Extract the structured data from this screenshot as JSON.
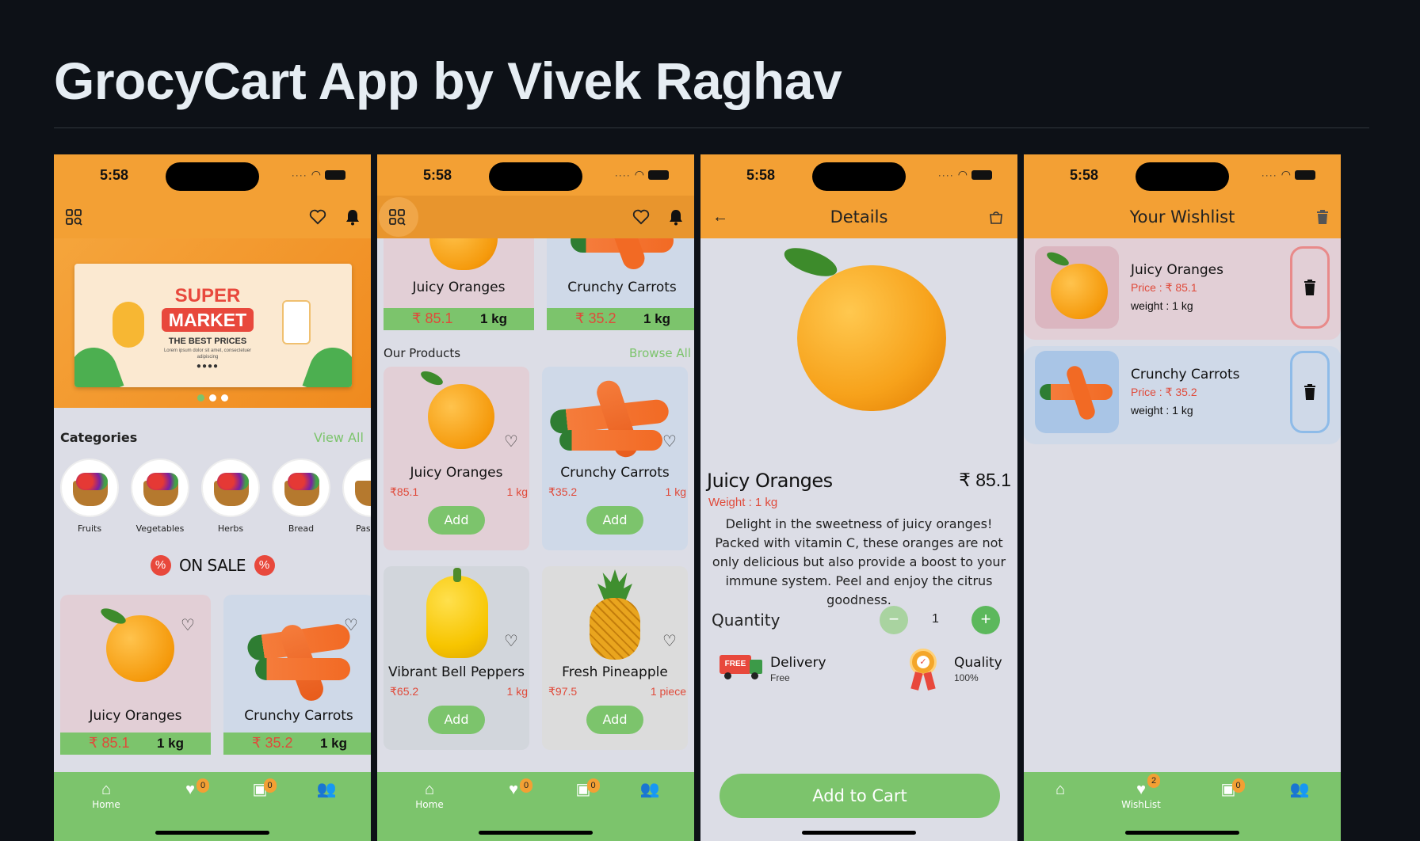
{
  "page": {
    "title": "GrocyCart App by Vivek Raghav"
  },
  "status": {
    "time": "5:58"
  },
  "colors": {
    "accent": "#f3a034",
    "green": "#7cc46c",
    "price_red": "#e04a3a",
    "background": "#0d1117"
  },
  "screen1": {
    "banner": {
      "line1": "SUPER",
      "line2": "MARKET",
      "line3": "THE BEST PRICES",
      "small": "Lorem ipsum dolor sit amet, consectetuer adipiscing"
    },
    "categories_title": "Categories",
    "view_all": "View All",
    "categories": [
      "Fruits",
      "Vegetables",
      "Herbs",
      "Bread",
      "Pas"
    ],
    "on_sale": "ON SALE",
    "sale_items": [
      {
        "name": "Juicy Oranges",
        "price": "₹ 85.1",
        "weight": "1 kg"
      },
      {
        "name": "Crunchy Carrots",
        "price": "₹ 35.2",
        "weight": "1 kg"
      }
    ],
    "nav": {
      "home": "Home",
      "wish_badge": "0",
      "cart_badge": "0"
    }
  },
  "screen2": {
    "top_items": [
      {
        "name": "Juicy Oranges",
        "price": "₹ 85.1",
        "weight": "1 kg"
      },
      {
        "name": "Crunchy Carrots",
        "price": "₹ 35.2",
        "weight": "1 kg"
      }
    ],
    "products_title": "Our Products",
    "browse_all": "Browse All",
    "products": [
      {
        "name": "Juicy Oranges",
        "price": "₹85.1",
        "unit": "1 kg",
        "add": "Add"
      },
      {
        "name": "Crunchy Carrots",
        "price": "₹35.2",
        "unit": "1 kg",
        "add": "Add"
      },
      {
        "name": "Vibrant Bell Peppers",
        "price": "₹65.2",
        "unit": "1 kg",
        "add": "Add"
      },
      {
        "name": "Fresh Pineapple",
        "price": "₹97.5",
        "unit": "1 piece",
        "add": "Add"
      }
    ],
    "nav": {
      "home": "Home",
      "wish_badge": "0",
      "cart_badge": "0"
    }
  },
  "screen3": {
    "title": "Details",
    "name": "Juicy Oranges",
    "price": "₹ 85.1",
    "weight": "Weight : 1 kg",
    "description": "Delight in the sweetness of juicy oranges! Packed with vitamin C, these oranges are not only delicious but also provide a boost to your immune system. Peel and enjoy the citrus goodness.",
    "quantity_label": "Quantity",
    "quantity": "1",
    "delivery_title": "Delivery",
    "delivery_sub": "Free",
    "free_badge": "FREE",
    "quality_title": "Quality",
    "quality_sub": "100%",
    "add_to_cart": "Add to Cart"
  },
  "screen4": {
    "title": "Your Wishlist",
    "items": [
      {
        "name": "Juicy Oranges",
        "price": "Price : ₹ 85.1",
        "weight": "weight : 1 kg"
      },
      {
        "name": "Crunchy Carrots",
        "price": "Price : ₹ 35.2",
        "weight": "weight : 1 kg"
      }
    ],
    "nav": {
      "wishlist": "WishList",
      "wish_badge": "2",
      "cart_badge": "0"
    }
  }
}
